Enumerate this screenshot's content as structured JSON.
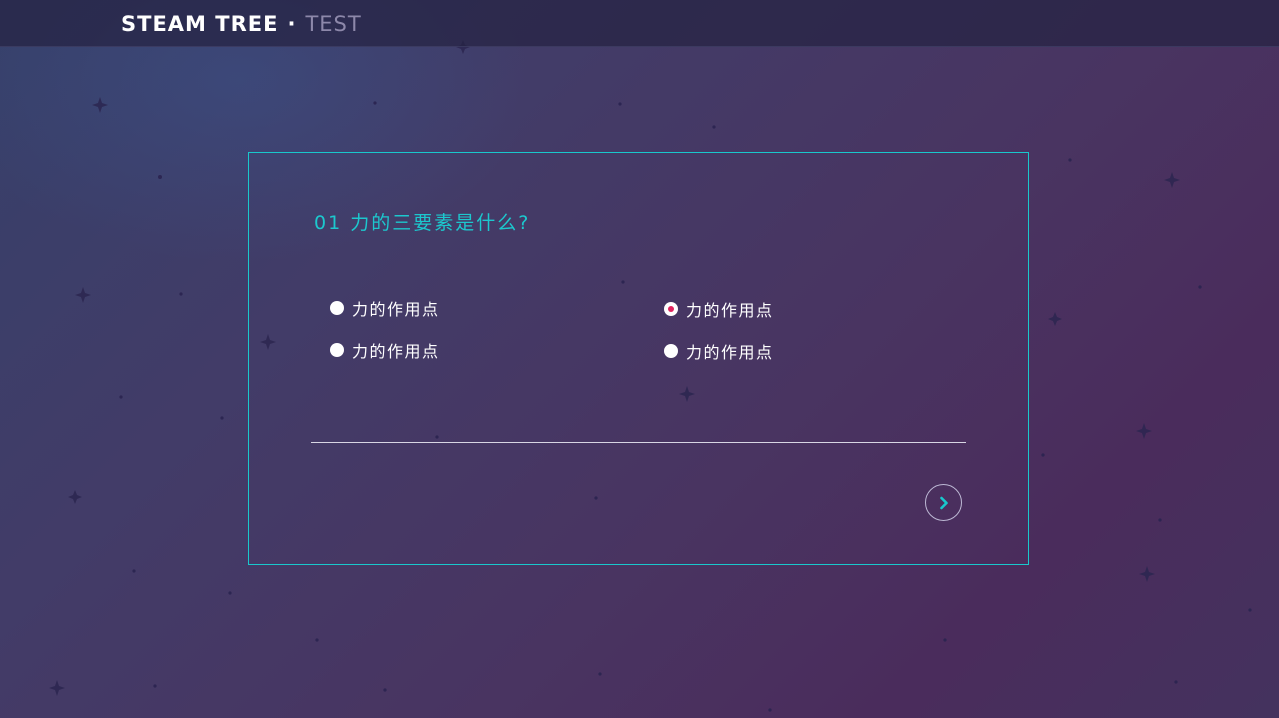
{
  "header": {
    "brand": "STEAM TREE",
    "separator": "·",
    "section": "TEST"
  },
  "quiz": {
    "question": "01 力的三要素是什么?",
    "options": [
      {
        "label": "力的作用点",
        "selected": false
      },
      {
        "label": "力的作用点",
        "selected": true
      },
      {
        "label": "力的作用点",
        "selected": false
      },
      {
        "label": "力的作用点",
        "selected": false
      }
    ],
    "next_icon": "chevron-right-icon"
  },
  "colors": {
    "accent": "#19c8cc",
    "selected_dot": "#e0245e",
    "header_sub": "#8d88aa"
  }
}
